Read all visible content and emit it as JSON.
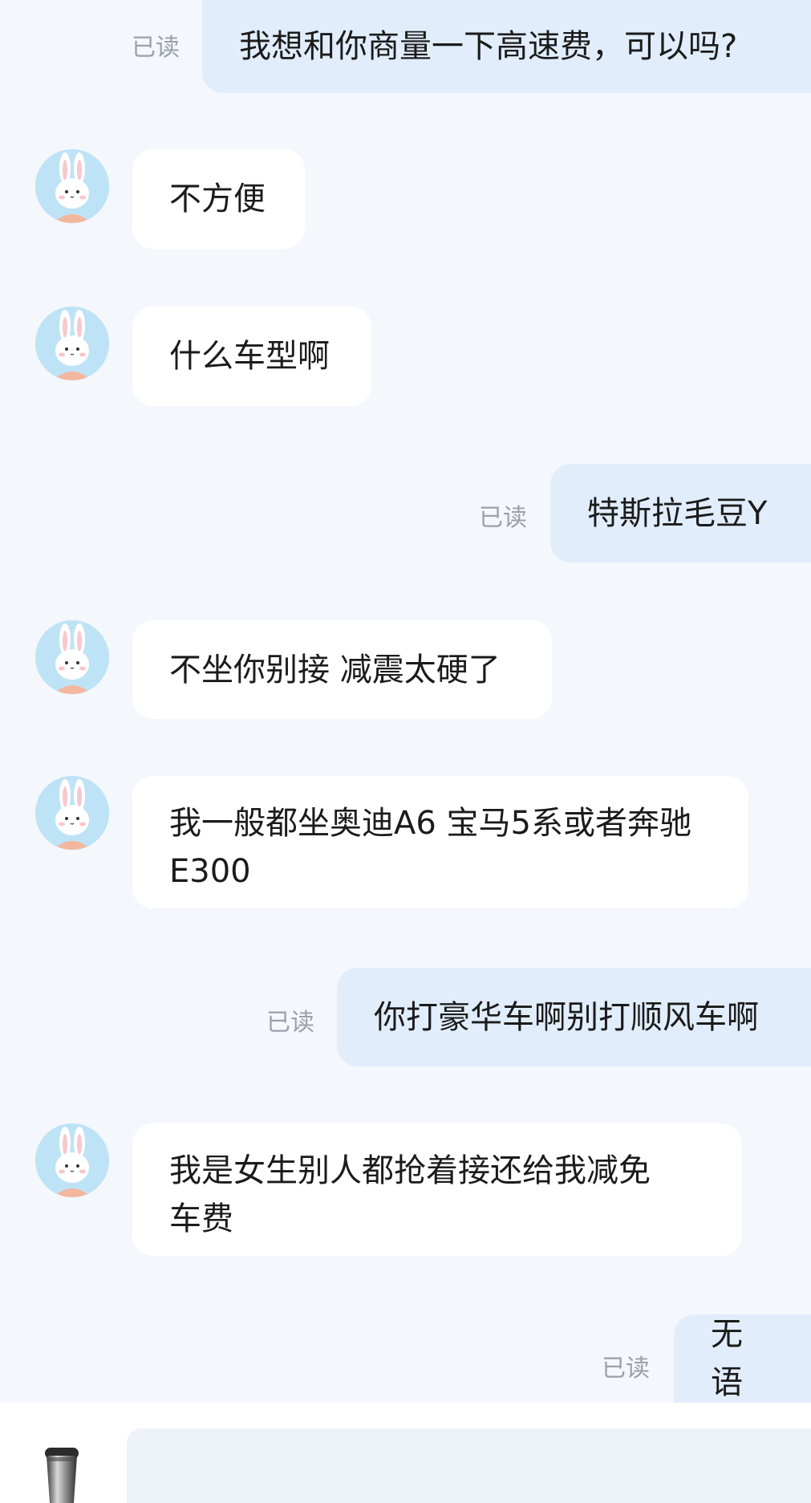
{
  "read_label": "已读",
  "messages": [
    {
      "from": "me",
      "text": "我想和你商量一下高速费，可以吗?"
    },
    {
      "from": "them",
      "text": "不方便"
    },
    {
      "from": "them",
      "text": "什么车型啊"
    },
    {
      "from": "me",
      "text": "特斯拉毛豆Y"
    },
    {
      "from": "them",
      "text": "不坐你别接 减震太硬了"
    },
    {
      "from": "them",
      "line1": "我一般都坐奥迪A6 宝马5系或者奔驰",
      "line2": "E300"
    },
    {
      "from": "me",
      "text": "你打豪华车啊别打顺风车啊"
    },
    {
      "from": "them",
      "line1": "我是女生别人都抢着接还给我减免",
      "line2": "车费"
    },
    {
      "from": "me",
      "text": "无语"
    }
  ],
  "input": {
    "placeholder": ""
  },
  "icons": {
    "avatar": "bunny-avatar-icon",
    "voice": "voice-icon"
  },
  "colors": {
    "background": "#f4f7fb",
    "incoming": "#ffffff",
    "outgoing": "#e1edfb",
    "read": "#9aa1ab"
  }
}
